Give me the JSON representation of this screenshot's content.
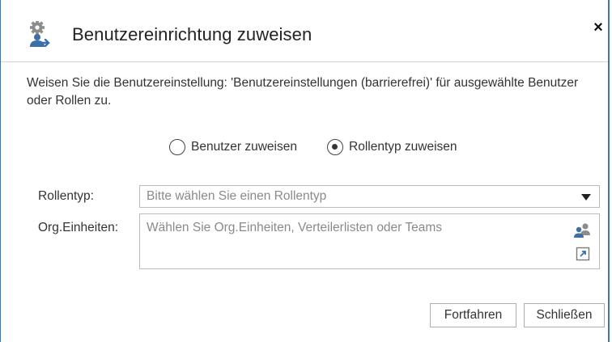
{
  "dialog": {
    "title": "Benutzereinrichtung zuweisen",
    "title_icon": "user-settings-gear-icon",
    "close_label": "×",
    "description": "Weisen Sie die Benutzereinstellung: 'Benutzereinstellungen (barrierefrei)' für ausgewählte Benutzer oder Rollen zu."
  },
  "assign_mode": {
    "options": [
      {
        "label": "Benutzer zuweisen",
        "selected": false
      },
      {
        "label": "Rollentyp zuweisen",
        "selected": true
      }
    ]
  },
  "form": {
    "role_type": {
      "label": "Rollentyp:",
      "placeholder": "Bitte wählen Sie einen Rollentyp"
    },
    "org_units": {
      "label": "Org.Einheiten:",
      "placeholder": "Wählen Sie Org.Einheiten, Verteilerlisten oder Teams",
      "icons": [
        "people-picker-icon",
        "expand-icon"
      ]
    }
  },
  "buttons": {
    "continue": "Fortfahren",
    "close": "Schließen"
  },
  "colors": {
    "frame": "#3f74a6",
    "icon_blue": "#3b6fa8",
    "placeholder": "#8a8a8a"
  }
}
